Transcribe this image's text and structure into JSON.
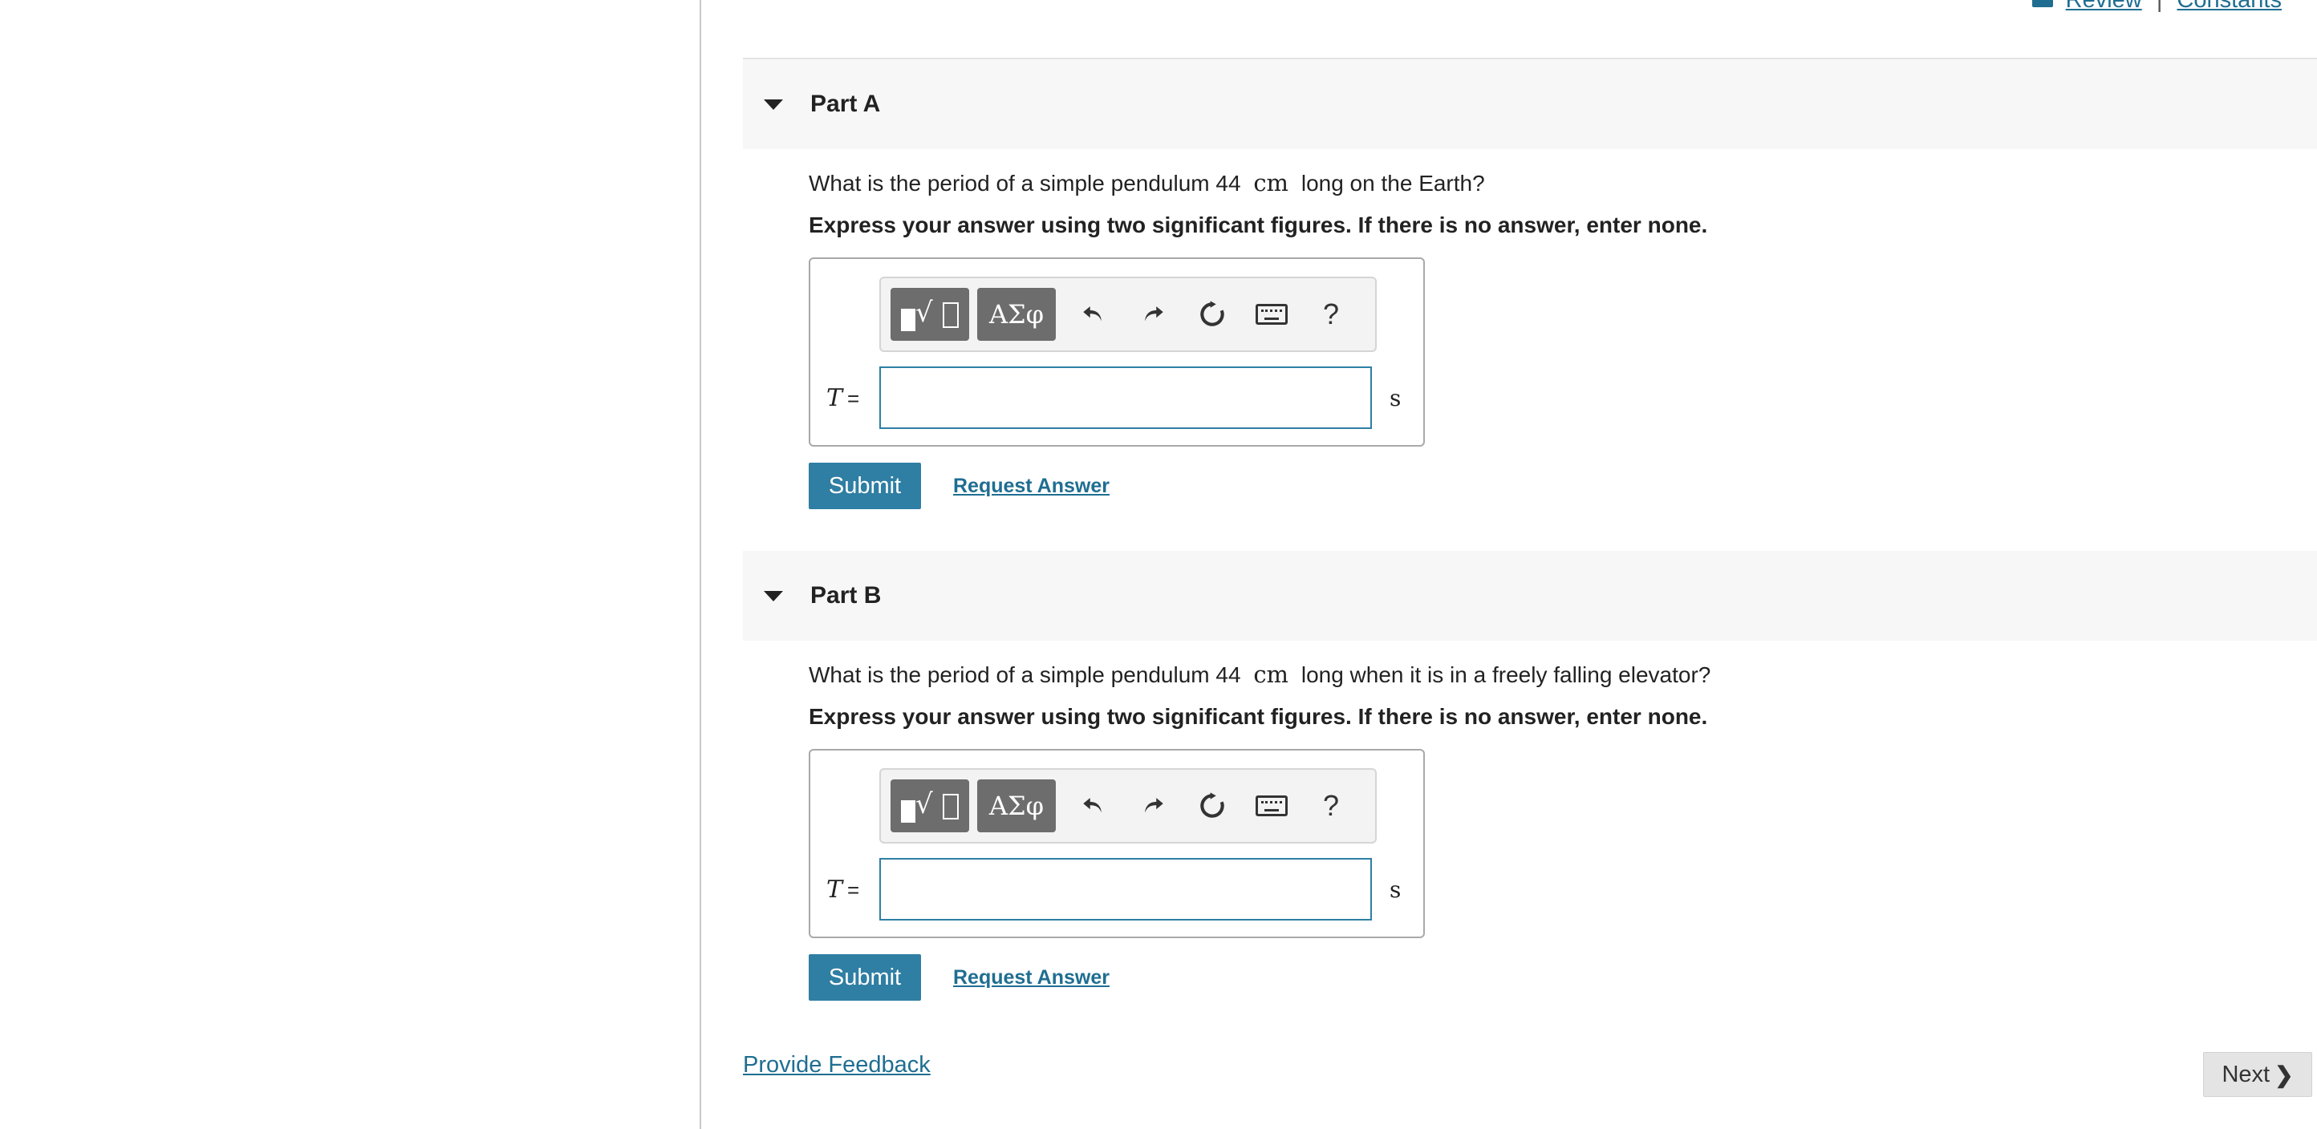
{
  "header": {
    "review_link": "Review",
    "separator": "|",
    "constants_link": "Constants"
  },
  "parts": [
    {
      "title": "Part A",
      "question_before": "What is the period of a simple pendulum 44",
      "question_unit": "cm",
      "question_after": "long on the Earth?",
      "instructions": "Express your answer using two significant figures. If there is no answer, enter none.",
      "toolbar": {
        "greek_label": "ΑΣφ",
        "help_label": "?",
        "icons": [
          "templates-icon",
          "greek-symbols-icon",
          "undo-icon",
          "redo-icon",
          "reset-icon",
          "keyboard-icon",
          "help-icon"
        ]
      },
      "variable": "T",
      "equals": "=",
      "answer_value": "",
      "unit": "s",
      "submit_label": "Submit",
      "request_label": "Request Answer"
    },
    {
      "title": "Part B",
      "question_before": "What is the period of a simple pendulum 44",
      "question_unit": "cm",
      "question_after": "long when it is in a freely falling elevator?",
      "instructions": "Express your answer using two significant figures. If there is no answer, enter none.",
      "toolbar": {
        "greek_label": "ΑΣφ",
        "help_label": "?",
        "icons": [
          "templates-icon",
          "greek-symbols-icon",
          "undo-icon",
          "redo-icon",
          "reset-icon",
          "keyboard-icon",
          "help-icon"
        ]
      },
      "variable": "T",
      "equals": "=",
      "answer_value": "",
      "unit": "s",
      "submit_label": "Submit",
      "request_label": "Request Answer"
    }
  ],
  "footer": {
    "feedback_link": "Provide Feedback",
    "next_label": "Next",
    "next_chevron": "❯"
  },
  "colors": {
    "accent": "#2f7ea3",
    "link": "#1f6e91",
    "header_bg": "#f7f7f7",
    "toolbar_dark": "#6d6d6d",
    "next_bg": "#e4e4e4"
  }
}
